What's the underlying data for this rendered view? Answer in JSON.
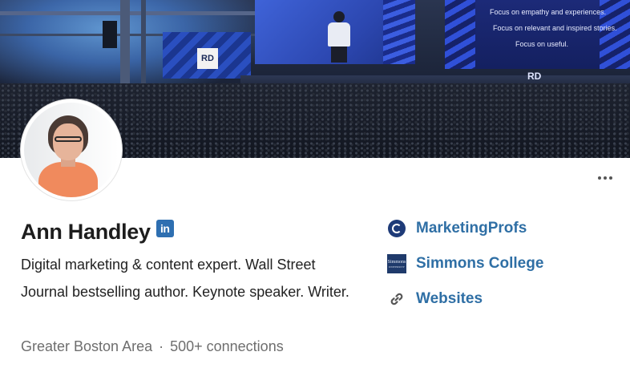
{
  "banner": {
    "stage_logo": "RD",
    "slide_lines": [
      "Focus on empathy and experiences.",
      "Focus on relevant and inspired stories.",
      "Focus on useful."
    ]
  },
  "profile": {
    "name": "Ann Handley",
    "linkedin_badge": "in",
    "headline": "Digital marketing & content expert. Wall Street Journal bestselling author. Keynote speaker. Writer.",
    "location": "Greater Boston Area",
    "separator": "·",
    "connections": "500+ connections"
  },
  "links": [
    {
      "label": "MarketingProfs",
      "icon": "company-globe-icon"
    },
    {
      "label": "Simmons College",
      "icon": "simmons-college-logo"
    },
    {
      "label": "Websites",
      "icon": "chain-link-icon"
    }
  ],
  "simmons_logo_text": {
    "main": "Simmons",
    "sub": "UNIVERSITY"
  },
  "colors": {
    "link": "#2f6fa5",
    "linkedin_blue": "#2e6fb1",
    "meta_gray": "#6e6e6e"
  }
}
